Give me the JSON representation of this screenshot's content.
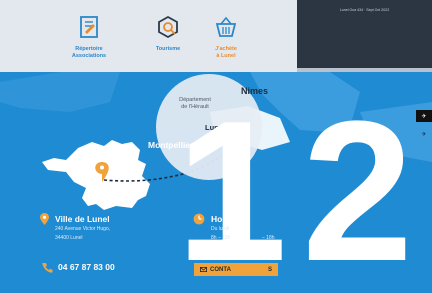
{
  "nav": {
    "items": [
      {
        "label": "Répertoire\nAssociations",
        "icon": "directory-icon"
      },
      {
        "label": "Tourisme",
        "icon": "tourism-icon"
      },
      {
        "label": "J'achète\nà Lunel",
        "icon": "basket-icon"
      }
    ]
  },
  "preview": {
    "ticker": "Lunel Oca 434 · Sept Oct 2022"
  },
  "map": {
    "department": "Département\nde l'Hérault",
    "cities": {
      "nimes": "Nimes",
      "lunel": "Lunel",
      "montpellier": "Montpellier"
    },
    "big_numbers": [
      "1",
      "2"
    ]
  },
  "contact": {
    "city_title": "Ville de Lunel",
    "address_line1": "240 Avenue Victor Hugo,",
    "address_line2": "34400 Lunel",
    "hours_title": "Horai",
    "hours_line1": "Du lundi",
    "hours_line2": "8h – 12h",
    "hours_line3": "– 18h",
    "phone": "04 67 87 83 00",
    "button_label": "CONTA",
    "button_suffix": "S"
  },
  "colors": {
    "blue": "#1f8bd3",
    "orange": "#f0a33a",
    "nav_bg": "#e3e8ef",
    "dark_panel": "#2c3542"
  }
}
